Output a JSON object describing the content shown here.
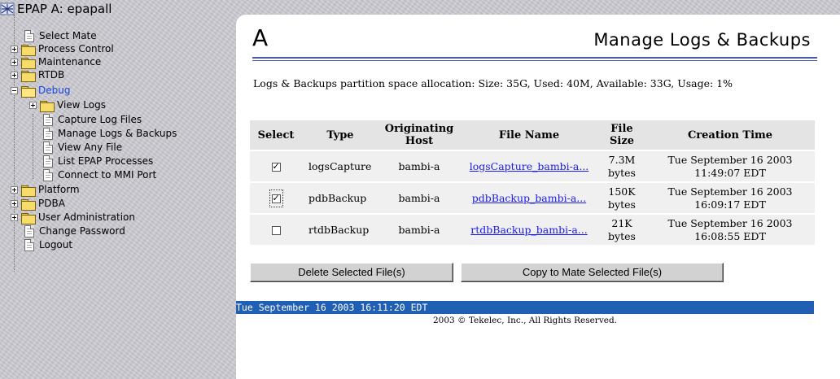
{
  "tree": {
    "root": "EPAP A: epapall",
    "items": [
      {
        "label": "Select Mate",
        "icon": "document-icon"
      },
      {
        "label": "Process Control",
        "icon": "folder-icon"
      },
      {
        "label": "Maintenance",
        "icon": "folder-icon"
      },
      {
        "label": "RTDB",
        "icon": "folder-icon"
      },
      {
        "label": "Debug",
        "icon": "folder-open-icon",
        "selected": true
      },
      {
        "label": "View Logs",
        "icon": "folder-icon"
      },
      {
        "label": "Capture Log Files",
        "icon": "document-icon"
      },
      {
        "label": "Manage Logs & Backups",
        "icon": "document-icon"
      },
      {
        "label": "View Any File",
        "icon": "document-icon"
      },
      {
        "label": "List EPAP Processes",
        "icon": "document-icon"
      },
      {
        "label": "Connect to MMI Port",
        "icon": "document-icon"
      },
      {
        "label": "Platform",
        "icon": "folder-icon"
      },
      {
        "label": "PDBA",
        "icon": "folder-icon"
      },
      {
        "label": "User Administration",
        "icon": "folder-icon"
      },
      {
        "label": "Change Password",
        "icon": "document-icon"
      },
      {
        "label": "Logout",
        "icon": "document-icon"
      }
    ]
  },
  "page": {
    "letter": "A",
    "title": "Manage Logs & Backups",
    "space_info": "Logs & Backups partition space allocation: Size: 35G, Used: 40M, Available: 33G, Usage: 1%"
  },
  "table": {
    "headers": [
      "Select",
      "Type",
      "Originating Host",
      "File Name",
      "File Size",
      "Creation Time"
    ],
    "rows": [
      {
        "checked": true,
        "type": "logsCapture",
        "host": "bambi-a",
        "file": "logsCapture_bambi-a...",
        "size": "7.3M bytes",
        "created": "Tue September 16 2003 11:49:07 EDT"
      },
      {
        "checked": true,
        "type": "pdbBackup",
        "host": "bambi-a",
        "file": "pdbBackup_bambi-a...",
        "size": "150K bytes",
        "created": "Tue September 16 2003 16:09:17 EDT"
      },
      {
        "checked": false,
        "type": "rtdbBackup",
        "host": "bambi-a",
        "file": "rtdbBackup_bambi-a...",
        "size": "21K bytes",
        "created": "Tue September 16 2003 16:08:55 EDT"
      }
    ]
  },
  "buttons": {
    "delete": "Delete Selected File(s)",
    "copy": "Copy to Mate Selected File(s)"
  },
  "footer": {
    "timestamp": "Tue September 16 2003 16:11:20 EDT",
    "copyright": "2003 © Tekelec, Inc., All Rights Reserved."
  },
  "colors": {
    "selected_tree_item": "#1c44e0",
    "status_bar": "#1f5fb4",
    "link": "#1a1aee"
  }
}
